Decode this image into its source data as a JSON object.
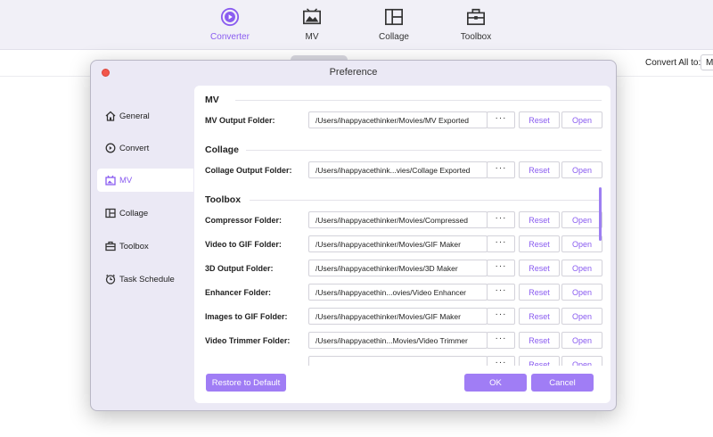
{
  "nav": {
    "items": [
      {
        "label": "Converter",
        "icon": "converter-icon",
        "active": true
      },
      {
        "label": "MV",
        "icon": "mv-icon"
      },
      {
        "label": "Collage",
        "icon": "collage-icon"
      },
      {
        "label": "Toolbox",
        "icon": "toolbox-icon"
      }
    ]
  },
  "toolbar": {
    "convert_all_label": "Convert All to:",
    "convert_all_value": "M"
  },
  "dialog": {
    "title": "Preference",
    "sidebar": [
      {
        "label": "General",
        "icon": "home-icon"
      },
      {
        "label": "Convert",
        "icon": "convert-icon"
      },
      {
        "label": "MV",
        "icon": "mv-icon",
        "active": true
      },
      {
        "label": "Collage",
        "icon": "collage-icon"
      },
      {
        "label": "Toolbox",
        "icon": "toolbox-icon"
      },
      {
        "label": "Task Schedule",
        "icon": "clock-icon"
      }
    ],
    "sections": [
      {
        "title": "MV",
        "rows": [
          {
            "label": "MV Output Folder:",
            "path": "/Users/ihappyacethinker/Movies/MV Exported"
          }
        ]
      },
      {
        "title": "Collage",
        "rows": [
          {
            "label": "Collage Output Folder:",
            "path": "/Users/ihappyacethink...vies/Collage Exported"
          }
        ]
      },
      {
        "title": "Toolbox",
        "rows": [
          {
            "label": "Compressor Folder:",
            "path": "/Users/ihappyacethinker/Movies/Compressed"
          },
          {
            "label": "Video to GIF Folder:",
            "path": "/Users/ihappyacethinker/Movies/GIF Maker"
          },
          {
            "label": "3D Output Folder:",
            "path": "/Users/ihappyacethinker/Movies/3D Maker"
          },
          {
            "label": "Enhancer Folder:",
            "path": "/Users/ihappyacethin...ovies/Video Enhancer"
          },
          {
            "label": "Images to GIF Folder:",
            "path": "/Users/ihappyacethinker/Movies/GIF Maker"
          },
          {
            "label": "Video Trimmer Folder:",
            "path": "/Users/ihappyacethin...Movies/Video Trimmer"
          },
          {
            "label": "",
            "path": ""
          }
        ]
      }
    ],
    "buttons": {
      "dots": "···",
      "reset": "Reset",
      "open": "Open",
      "restore": "Restore to Default",
      "ok": "OK",
      "cancel": "Cancel"
    },
    "colors": {
      "accent": "#a07df5",
      "accent_text": "#8a5cf0",
      "close": "#f2574b"
    }
  }
}
